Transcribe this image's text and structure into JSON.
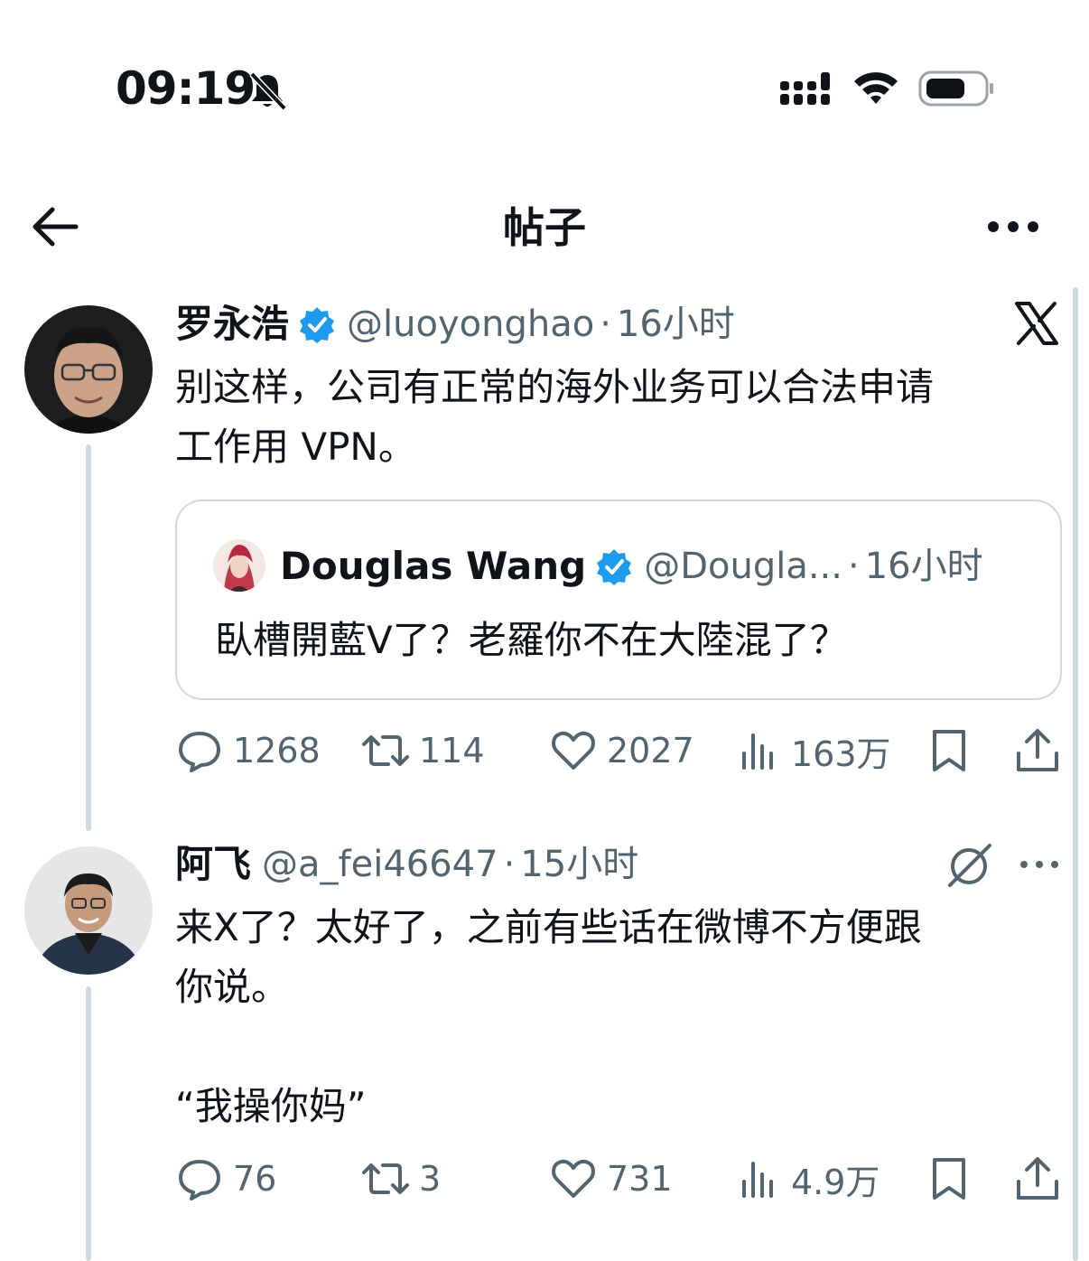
{
  "status_bar": {
    "time": "09:19"
  },
  "nav": {
    "title": "帖子"
  },
  "tweet": {
    "name": "罗永浩",
    "handle": "@luoyonghao",
    "time": "16小时",
    "text_line1": "别这样，公司有正常的海外业务可以合法申请",
    "text_line2": "工作用 VPN。",
    "quote": {
      "name": "Douglas Wang",
      "handle": "@Dougla...",
      "time": "16小时",
      "text": "臥槽開藍V了？老羅你不在大陸混了？"
    },
    "stats": {
      "replies": "1268",
      "retweets": "114",
      "likes": "2027",
      "views": "163万"
    }
  },
  "reply": {
    "name": "阿飞",
    "handle": "@a_fei46647",
    "time": "15小时",
    "text_line1": "来X了？太好了，之前有些话在微博不方便跟",
    "text_line2": "你说。",
    "text_line3": "“我操你妈”",
    "stats": {
      "replies": "76",
      "retweets": "3",
      "likes": "731",
      "views": "4.9万"
    }
  },
  "colors": {
    "verified": "#1d9bf0",
    "secondary_text": "#536471",
    "divider": "#cfd9de"
  }
}
